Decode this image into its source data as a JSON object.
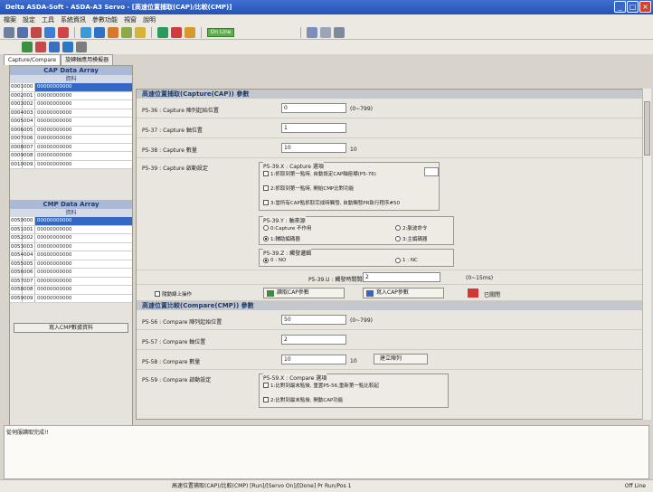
{
  "window": {
    "title": "Delta ASDA-Soft - ASDA-A3 Servo - [高速位置捕取(CAP)/比較(CMP)]"
  },
  "menu": [
    "檔案",
    "設定",
    "工具",
    "系統資訊",
    "參數功能",
    "視窗",
    "說明"
  ],
  "toolbar": {
    "online_label": "On Line"
  },
  "tabs": [
    "Capture/Compare",
    "旋轉軸應用模擬器"
  ],
  "cap_array": {
    "title": "CAP Data Array",
    "subheader": "資料",
    "rows": [
      [
        "0001",
        "000",
        "00000000000"
      ],
      [
        "0002",
        "001",
        "00000000000"
      ],
      [
        "0003",
        "002",
        "00000000000"
      ],
      [
        "0004",
        "003",
        "00000000000"
      ],
      [
        "0005",
        "004",
        "00000000000"
      ],
      [
        "0006",
        "005",
        "00000000000"
      ],
      [
        "0007",
        "006",
        "00000000000"
      ],
      [
        "0008",
        "007",
        "00000000000"
      ],
      [
        "0009",
        "008",
        "00000000000"
      ],
      [
        "0010",
        "009",
        "00000000000"
      ]
    ]
  },
  "cmp_array": {
    "title": "CMP Data Array",
    "subheader": "資料",
    "rows": [
      [
        "0050",
        "000",
        "00000000000"
      ],
      [
        "0051",
        "001",
        "00000000000"
      ],
      [
        "0052",
        "002",
        "00000000000"
      ],
      [
        "0053",
        "003",
        "00000000000"
      ],
      [
        "0054",
        "004",
        "00000000000"
      ],
      [
        "0055",
        "005",
        "00000000000"
      ],
      [
        "0056",
        "006",
        "00000000000"
      ],
      [
        "0057",
        "007",
        "00000000000"
      ],
      [
        "0058",
        "008",
        "00000000000"
      ],
      [
        "0059",
        "009",
        "00000000000"
      ]
    ],
    "write_button": "寫入CMP數據資料"
  },
  "capture": {
    "section_title": "高速位置捕取(Capture(CAP)) 參數",
    "p536_label": "P5-36 : Capture 陣列起始位置",
    "p536_value": "0",
    "p536_range": "(0~799)",
    "p537_label": "P5-37 : Capture 軸位置",
    "p537_value": "1",
    "p538_label": "P5-38 : Capture 數量",
    "p538_value": "10",
    "p538_suffix": "10",
    "p539_label": "P5-39 : Capture 啟動設定",
    "p539x_title": "P5-39.X : Capture 選項",
    "p539x_opt1": "1:抓取到第一點時, 自動設定CAP軸座標(P5-76)",
    "p539x_opt2": "2:抓取到第一點時, 開始CMP比對功能",
    "p539x_opt3": "3:當所有CAP點抓取完成時觸發, 自動觸發PR執行程序#50",
    "p539y_title": "P5-39.Y : 軸來源",
    "src_opt0": "0:Capture 不作用",
    "src_opt1": "1:輔助編碼器",
    "src_opt2": "2:脈波命令",
    "src_opt3": "3:主編碼器",
    "p539z_title": "P5-39.Z : 觸發邏輯",
    "logic_no": "0 : NO",
    "logic_nc": "1 : NC",
    "p539u_label": "P5-39.U : 觸發時間間隔",
    "p539u_value": "2",
    "p539u_range": "(0~15ms)",
    "check_online": "隨動線上操作",
    "btn_read": "讀取CAP參數",
    "btn_write": "寫入CAP參數",
    "btn_stop": "已關閉"
  },
  "compare": {
    "section_title": "高速位置比較(Compare(CMP)) 參數",
    "p556_label": "P5-56 : Compare 陣列起始位置",
    "p556_value": "50",
    "p556_range": "(0~799)",
    "p557_label": "P5-57 : Compare 軸位置",
    "p557_value": "2",
    "p558_label": "P5-58 : Compare 數量",
    "p558_value": "10",
    "p558_suffix": "10",
    "btn_build": "建立陣列",
    "p559_label": "P5-59 : Compare 啟動設定",
    "p559x_title": "P5-59.X : Compare 選項",
    "p559x_opt1": "1:比對到最末點後, 重置P5-56,重新第一點比較起",
    "p559x_opt2": "2:比對到最末點後, 開動CAP功能"
  },
  "log": {
    "text": "從伺服讀取完成!!"
  },
  "status": {
    "message": "高速位置捕取(CAP)/比較(CMP) [Run]/[Servo On]/[Done] Pr Run/Pos 1",
    "online": "Off Line"
  }
}
